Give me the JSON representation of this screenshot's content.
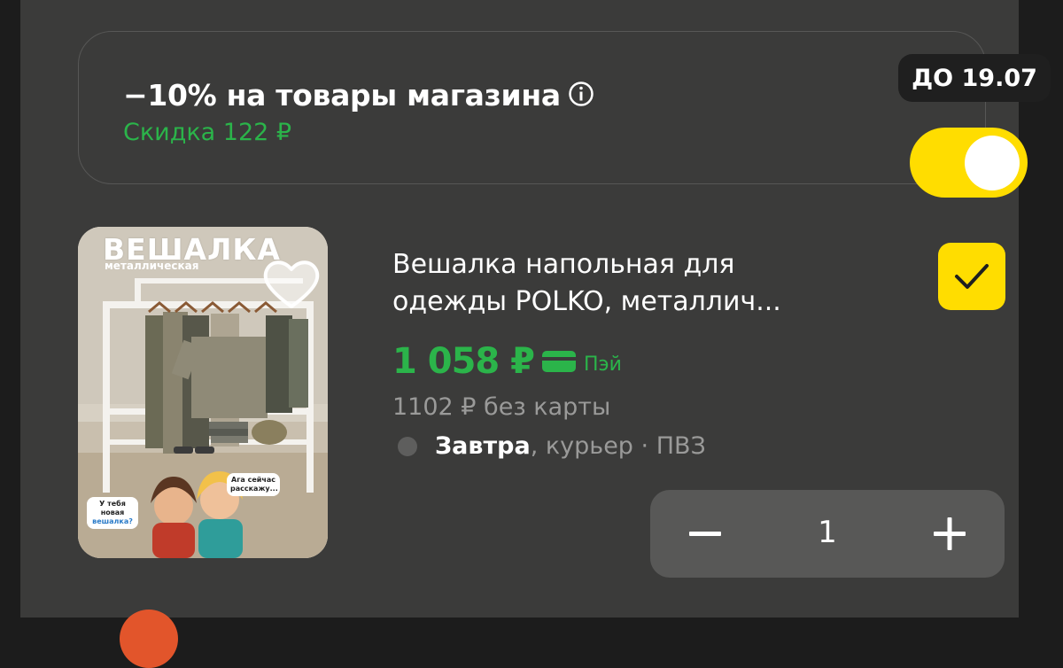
{
  "promo": {
    "title": "−10% на товары магазина",
    "discount_text": "Скидка 122 ₽",
    "deadline_badge": "ДО 19.07",
    "toggle_on": true,
    "icons": {
      "info": "info-circle-icon"
    }
  },
  "product": {
    "image_headline": "ВЕШАЛКА",
    "image_subline": "металлическая",
    "image_bubble_1": "Ага сейчас расскажу...",
    "image_bubble_2_a": "У тебя новая",
    "image_bubble_2_b": "вешалка?",
    "title_line_1": "Вешалка напольная для",
    "title_line_2": "одежды POLKO, металлич...",
    "price": "1 058 ₽",
    "payment_label": "Пэй",
    "old_price_text": "1102 ₽ без карты",
    "delivery_day": "Завтра",
    "delivery_options": ", курьер · ПВЗ",
    "selected": true,
    "quantity": "1",
    "icons": {
      "favorite": "heart-icon",
      "payment": "card-icon",
      "check": "checkmark-icon",
      "minus": "minus-icon",
      "plus": "plus-icon"
    }
  },
  "colors": {
    "accent_yellow": "#ffdd00",
    "price_green": "#2bb44a",
    "panel_bg": "#3b3b3a"
  }
}
